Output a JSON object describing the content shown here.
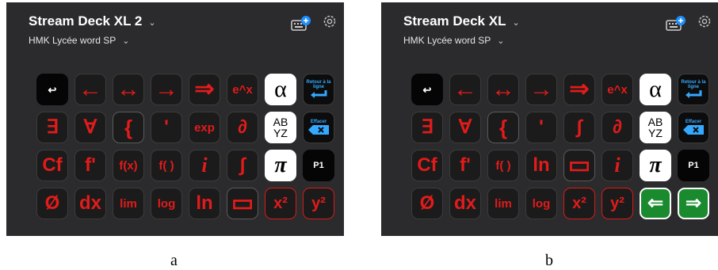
{
  "colors": {
    "panel_bg": "#2b2b2d",
    "key_bg": "#1b1b1b",
    "key_red": "#e31b1b",
    "accent_blue": "#1e90ff",
    "green": "#1a8a2e"
  },
  "panels": [
    {
      "device_title": "Stream Deck XL 2",
      "profile": "HMK Lycée word SP",
      "caption": "a",
      "keys": [
        [
          {
            "label": "↩",
            "style": "black-small",
            "icon": "back-arrow-icon"
          },
          {
            "label": "←",
            "style": "arrow"
          },
          {
            "label": "↔",
            "style": "arrow"
          },
          {
            "label": "→",
            "style": "arrow"
          },
          {
            "label": "⇒",
            "style": "arrow"
          },
          {
            "label": "e^x",
            "style": "text-sm"
          },
          {
            "label": "α",
            "style": "white"
          },
          {
            "label": "Retour à la ligne",
            "style": "retour"
          }
        ],
        [
          {
            "label": "∃",
            "style": "text-lg"
          },
          {
            "label": "∀",
            "style": "text-lg"
          },
          {
            "label": "{",
            "style": "brace"
          },
          {
            "label": "'",
            "style": "text-lg"
          },
          {
            "label": "exp",
            "style": "text-sm"
          },
          {
            "label": "∂",
            "style": "text-lg"
          },
          {
            "label": "AB\nYZ",
            "style": "white-abyz"
          },
          {
            "label": "Effacer",
            "style": "effacer"
          }
        ],
        [
          {
            "label": "Cf",
            "style": "text-lg"
          },
          {
            "label": "f'",
            "style": "text-lg"
          },
          {
            "label": "f(x)",
            "style": "text-sm"
          },
          {
            "label": "f( )",
            "style": "text-sm"
          },
          {
            "label": "i",
            "style": "italic"
          },
          {
            "label": "∫",
            "style": "text-lg"
          },
          {
            "label": "π",
            "style": "white-pi"
          },
          {
            "label": "P1",
            "style": "black"
          }
        ],
        [
          {
            "label": "Ø",
            "style": "text-lg"
          },
          {
            "label": "dx",
            "style": "text-lg"
          },
          {
            "label": "lim",
            "style": "text-sm"
          },
          {
            "label": "log",
            "style": "text-sm"
          },
          {
            "label": "ln",
            "style": "text-lg"
          },
          {
            "label": "▭",
            "style": "rect"
          },
          {
            "label": "x²",
            "style": "red-border"
          },
          {
            "label": "y²",
            "style": "red-border"
          }
        ]
      ]
    },
    {
      "device_title": "Stream Deck XL",
      "profile": "HMK Lycée word SP",
      "caption": "b",
      "keys": [
        [
          {
            "label": "↩",
            "style": "black-small",
            "icon": "back-arrow-icon"
          },
          {
            "label": "←",
            "style": "arrow"
          },
          {
            "label": "↔",
            "style": "arrow"
          },
          {
            "label": "→",
            "style": "arrow"
          },
          {
            "label": "⇒",
            "style": "arrow"
          },
          {
            "label": "e^x",
            "style": "text-sm"
          },
          {
            "label": "α",
            "style": "white"
          },
          {
            "label": "Retour à la ligne",
            "style": "retour"
          }
        ],
        [
          {
            "label": "∃",
            "style": "text-lg"
          },
          {
            "label": "∀",
            "style": "text-lg"
          },
          {
            "label": "{",
            "style": "brace"
          },
          {
            "label": "'",
            "style": "text-lg"
          },
          {
            "label": "∫",
            "style": "text-lg"
          },
          {
            "label": "∂",
            "style": "text-lg"
          },
          {
            "label": "AB\nYZ",
            "style": "white-abyz"
          },
          {
            "label": "Effacer",
            "style": "effacer"
          }
        ],
        [
          {
            "label": "Cf",
            "style": "text-lg"
          },
          {
            "label": "f'",
            "style": "text-lg"
          },
          {
            "label": "f( )",
            "style": "text-sm"
          },
          {
            "label": "ln",
            "style": "text-lg"
          },
          {
            "label": "▭",
            "style": "rect"
          },
          {
            "label": "i",
            "style": "italic"
          },
          {
            "label": "π",
            "style": "white-pi"
          },
          {
            "label": "P1",
            "style": "black"
          }
        ],
        [
          {
            "label": "Ø",
            "style": "text-lg"
          },
          {
            "label": "dx",
            "style": "text-lg"
          },
          {
            "label": "lim",
            "style": "text-sm"
          },
          {
            "label": "log",
            "style": "text-sm"
          },
          {
            "label": "x²",
            "style": "red-border"
          },
          {
            "label": "y²",
            "style": "red-border"
          },
          {
            "label": "⇐",
            "style": "green",
            "icon": "arrow-left-icon"
          },
          {
            "label": "⇒",
            "style": "green",
            "icon": "arrow-right-icon"
          }
        ]
      ]
    }
  ]
}
